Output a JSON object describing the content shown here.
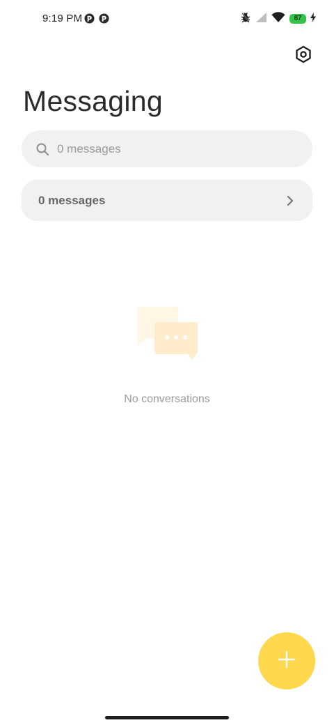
{
  "status_bar": {
    "time": "9:19 PM",
    "battery_level": "87",
    "app_icons": [
      "app-notification-icon",
      "app-notification-icon"
    ],
    "indicators": [
      "bug-icon",
      "cellular-signal-icon",
      "wifi-icon",
      "battery-icon",
      "charging-bolt-icon"
    ]
  },
  "header": {
    "title": "Messaging",
    "settings_icon": "settings-hexagon-icon"
  },
  "search": {
    "placeholder": "0 messages",
    "icon": "search-icon"
  },
  "messages_row": {
    "label": "0 messages",
    "icon": "chevron-right-icon"
  },
  "empty_state": {
    "icon": "chat-bubbles-icon",
    "text": "No conversations"
  },
  "fab": {
    "icon": "plus-icon"
  },
  "colors": {
    "accent": "#ffd84d",
    "surface": "#f1f1f1",
    "battery": "#35c24a"
  }
}
